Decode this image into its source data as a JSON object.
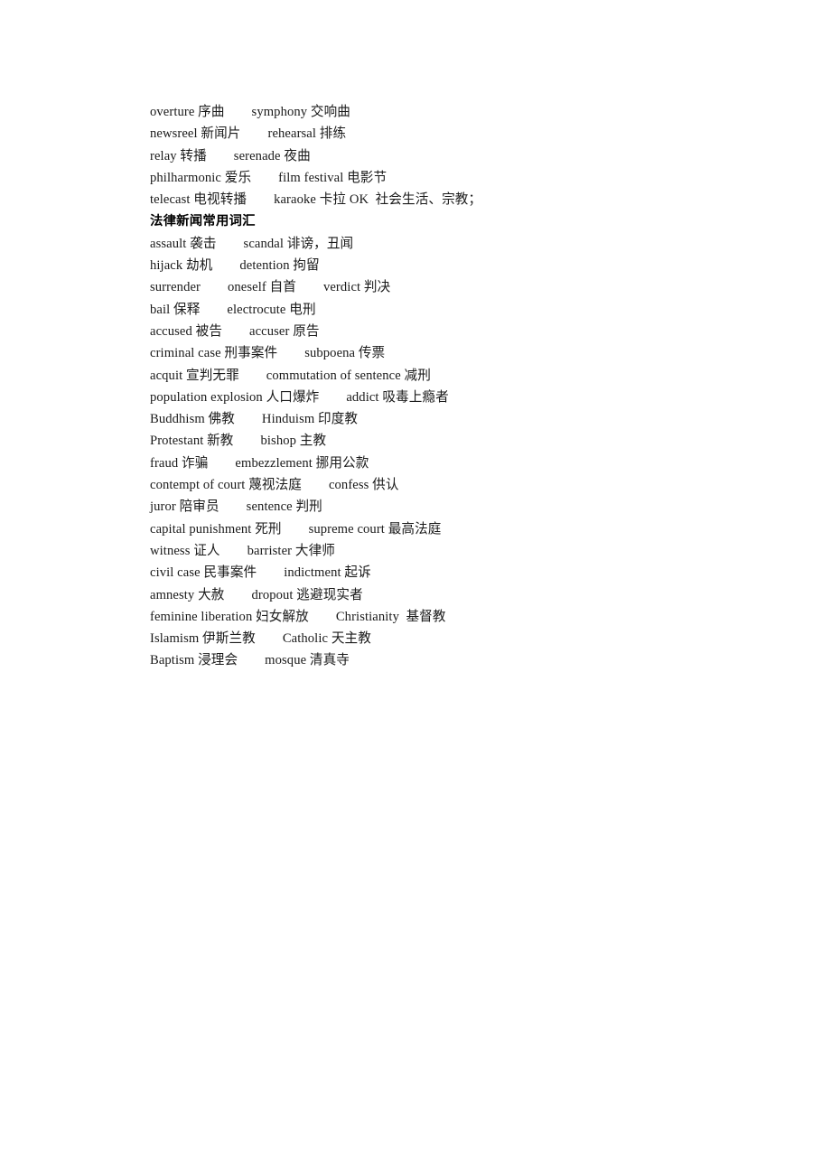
{
  "document": {
    "page_background": "#ffffff",
    "text_color": "#1a1a1a",
    "sections": [
      {
        "id": "arts-media-tail",
        "lines": [
          "overture 序曲        symphony 交响曲",
          "newsreel 新闻片        rehearsal 排练",
          "relay 转播        serenade 夜曲",
          "philharmonic 爱乐        film festival 电影节",
          "telecast 电视转播        karaoke 卡拉 OK  社会生活、宗教；"
        ]
      },
      {
        "id": "law-news-vocabulary",
        "heading": "法律新闻常用词汇",
        "lines": [
          "assault 袭击        scandal 诽谤，丑闻",
          "hijack 劫机        detention 拘留",
          "surrender        oneself 自首        verdict 判决",
          "bail 保释        electrocute 电刑",
          "accused 被告        accuser 原告",
          "criminal case 刑事案件        subpoena 传票",
          "acquit 宣判无罪        commutation of sentence 减刑",
          "population explosion 人口爆炸        addict 吸毒上瘾者",
          "Buddhism 佛教        Hinduism 印度教",
          "Protestant 新教        bishop 主教",
          "fraud 诈骗        embezzlement 挪用公款",
          "contempt of court 蔑视法庭        confess 供认",
          "juror 陪审员        sentence 判刑",
          "capital punishment 死刑        supreme court 最高法庭",
          "witness 证人        barrister 大律师",
          "civil case 民事案件        indictment 起诉",
          "amnesty 大赦        dropout 逃避现实者",
          "feminine liberation 妇女解放        Christianity  基督教",
          "Islamism 伊斯兰教        Catholic 天主教",
          "Baptism 浸理会        mosque 清真寺"
        ]
      }
    ]
  }
}
